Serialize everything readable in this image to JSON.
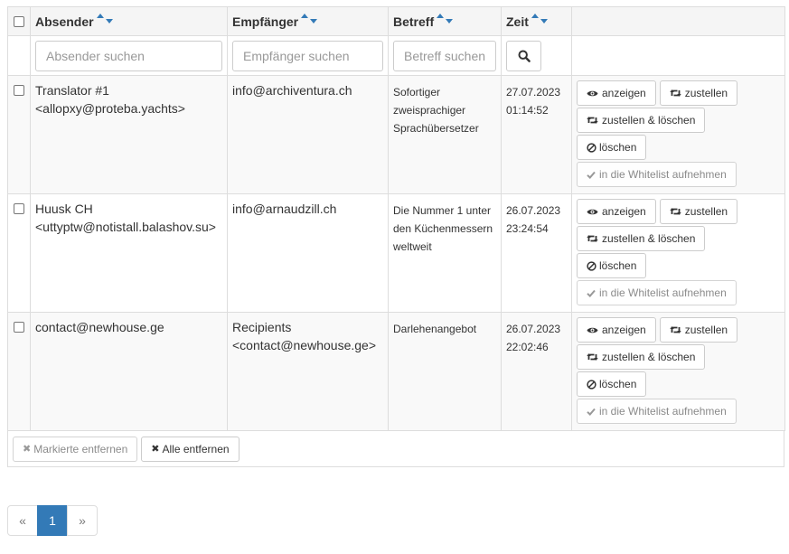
{
  "table": {
    "headers": {
      "sender": "Absender",
      "recipient": "Empfänger",
      "subject": "Betreff",
      "time": "Zeit"
    },
    "search": {
      "sender_placeholder": "Absender suchen",
      "recipient_placeholder": "Empfänger suchen",
      "subject_placeholder": "Betreff suchen"
    },
    "actions": {
      "view": "anzeigen",
      "deliver": "zustellen",
      "deliver_delete": "zustellen & löschen",
      "delete": "löschen",
      "whitelist": "in die Whitelist aufnehmen"
    },
    "rows": [
      {
        "sender_name": "Translator #1",
        "sender_addr": "<allopxy@proteba.yachts>",
        "recipient_name": "info@archiventura.ch",
        "recipient_addr": "",
        "subject": "Sofortiger zweisprachiger Sprachübersetzer",
        "date": "27.07.2023",
        "time": "01:14:52"
      },
      {
        "sender_name": "Huusk CH",
        "sender_addr": "<uttyptw@notistall.balashov.su>",
        "recipient_name": "info@arnaudzill.ch",
        "recipient_addr": "",
        "subject": "Die Nummer 1 unter den Küchenmessern weltweit",
        "date": "26.07.2023",
        "time": "23:24:54"
      },
      {
        "sender_name": "contact@newhouse.ge",
        "sender_addr": "",
        "recipient_name": "Recipients",
        "recipient_addr": "<contact@newhouse.ge>",
        "subject": "Darlehenangebot",
        "date": "26.07.2023",
        "time": "22:02:46"
      }
    ]
  },
  "footer": {
    "remove_marked": "Markierte entfernen",
    "remove_all": "Alle entfernen"
  },
  "pagination": {
    "prev": "«",
    "current": "1",
    "next": "»"
  },
  "colors": {
    "accent": "#337ab7",
    "border": "#dddddd",
    "stripe": "#f9f9f9"
  }
}
